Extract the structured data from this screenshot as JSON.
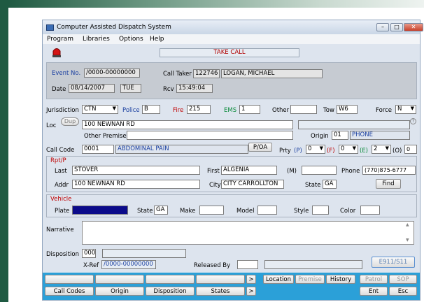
{
  "window": {
    "title": "Computer Assisted Dispatch System",
    "colors": {
      "frame": "#1f5a42",
      "bottom_band": "#2ba0d8",
      "dark_plate": "#0b0b8a"
    }
  },
  "menu": [
    "Program",
    "Libraries",
    "Options",
    "Help"
  ],
  "alert": {
    "icon": "siren-icon",
    "mode": "TAKE CALL"
  },
  "event": {
    "event_no_label": "Event No.",
    "event_no": "/0000-00000000",
    "call_taker_label": "Call Taker",
    "call_taker_id": "122746",
    "call_taker_name": "LOGAN, MICHAEL",
    "date_label": "Date",
    "date": "08/14/2007",
    "day": "TUE",
    "rcv_label": "Rcv",
    "rcv": "15:49:04"
  },
  "jurisdiction": {
    "label": "Jurisdiction",
    "value": "CTN",
    "police_label": "Police",
    "police": "B",
    "fire_label": "Fire",
    "fire": "215",
    "ems_label": "EMS",
    "ems": "1",
    "other_label": "Other",
    "other": "",
    "tow_label": "Tow",
    "tow": "W6",
    "force_label": "Force",
    "force": "N"
  },
  "location": {
    "loc_label": "Loc",
    "dup_label": "Dup",
    "loc": "100 NEWNAN RD",
    "other_premise_label": "Other Premise",
    "other_premise": "",
    "origin_label": "Origin",
    "origin_code": "01",
    "origin_name": "PHONE"
  },
  "call": {
    "call_code_label": "Call Code",
    "code": "0001",
    "description": "ABDOMINAL PAIN",
    "poa_label": "P/OA",
    "prty_label": "Prty",
    "p_label": "(P)",
    "p_value": "0",
    "f_label": "(F)",
    "f_value": "0",
    "e_label": "(E)",
    "e_value": "2",
    "o_label": "(O)",
    "o_value": "0"
  },
  "rpt": {
    "section_label": "Rpt/P",
    "last_label": "Last",
    "last": "STOVER",
    "first_label": "First",
    "first": "ALGENIA",
    "m_label": "(M)",
    "m": "",
    "phone_label": "Phone",
    "phone": "(770)875-6777",
    "addr_label": "Addr",
    "addr": "100 NEWNAN RD",
    "city_label": "City",
    "city": "CITY CARROLLTON",
    "state_label": "State",
    "state": "GA",
    "find_label": "Find"
  },
  "vehicle": {
    "section_label": "Vehicle",
    "plate_label": "Plate",
    "state_label": "State",
    "state": "GA",
    "make_label": "Make",
    "model_label": "Model",
    "style_label": "Style",
    "color_label": "Color"
  },
  "narrative": {
    "label": "Narrative",
    "value": ""
  },
  "disposition": {
    "label": "Disposition",
    "code": "000",
    "xref_label": "X-Ref",
    "xref": "/0000-00000000",
    "released_by_label": "Released By",
    "e911_label": "E911/S11"
  },
  "bottom": {
    "row1_right": [
      "Location",
      "Premise",
      "History",
      "Patrol",
      "SOP"
    ],
    "row1_arrow": ">",
    "row2_left": [
      "Call Codes",
      "Origin",
      "Disposition",
      "States"
    ],
    "row2_arrow": ">",
    "row2_right": [
      "Ent",
      "Esc"
    ]
  }
}
